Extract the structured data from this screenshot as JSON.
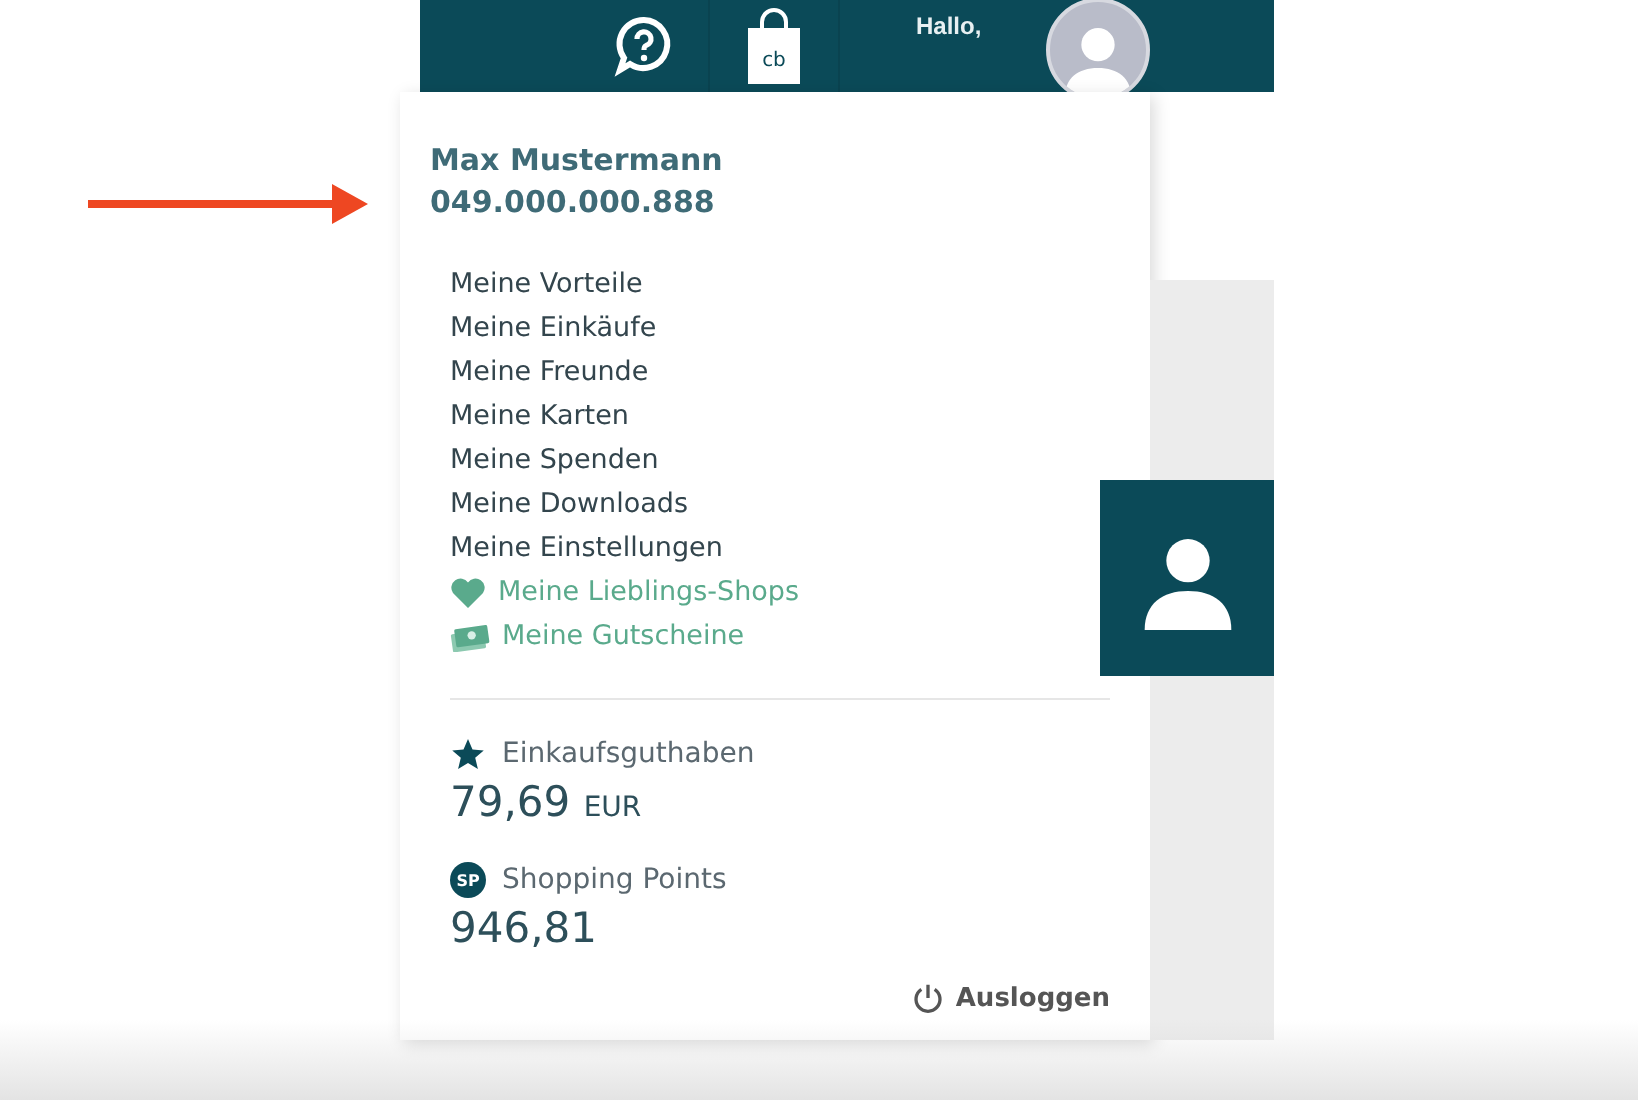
{
  "topbar": {
    "shop_logo": {
      "text": "cb"
    },
    "greeting": "Hallo,"
  },
  "account": {
    "name": "Max Mustermann",
    "number": "049.000.000.888"
  },
  "menu": [
    {
      "label": "Meine Vorteile",
      "kind": "plain"
    },
    {
      "label": "Meine Einkäufe",
      "kind": "plain"
    },
    {
      "label": "Meine Freunde",
      "kind": "plain"
    },
    {
      "label": "Meine Karten",
      "kind": "plain"
    },
    {
      "label": "Meine Spenden",
      "kind": "plain"
    },
    {
      "label": "Meine Downloads",
      "kind": "plain"
    },
    {
      "label": "Meine Einstellungen",
      "kind": "plain"
    },
    {
      "label": "Meine Lieblings-Shops",
      "kind": "heart"
    },
    {
      "label": "Meine Gutscheine",
      "kind": "money"
    }
  ],
  "balances": [
    {
      "kind": "star",
      "label": "Einkaufsguthaben",
      "value": "79,69",
      "unit": "EUR"
    },
    {
      "kind": "points",
      "badge": "SP",
      "label": "Shopping Points",
      "value": "946,81"
    }
  ],
  "logout": "Ausloggen"
}
